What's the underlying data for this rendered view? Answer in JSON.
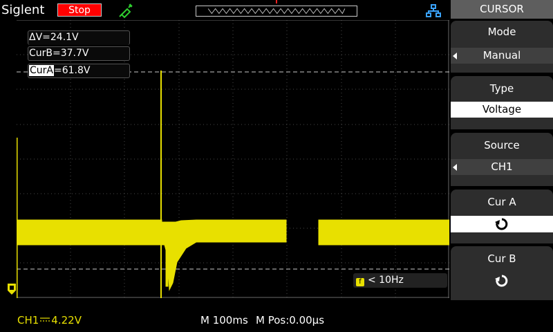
{
  "header": {
    "brand": "Siglent",
    "run_state": "Stop"
  },
  "cursor_readouts": {
    "delta": "ΔV=24.1V",
    "cur_b": "CurB=37.7V",
    "cur_a_label": "CurA",
    "cur_a_value": "=61.8V"
  },
  "trigger": {
    "freq_icon": "f",
    "freq_text": "< 10Hz"
  },
  "status": {
    "channel": "CH1",
    "coupling_icon": "dc-coupling-icon",
    "channel_scale": "4.22V",
    "timebase": "M 100ms",
    "position": "M Pos:0.00μs"
  },
  "menu": {
    "title": "CURSOR",
    "mode_label": "Mode",
    "mode_value": "Manual",
    "type_label": "Type",
    "type_value": "Voltage",
    "source_label": "Source",
    "source_value": "CH1",
    "cur_a_label": "Cur A",
    "cur_b_label": "Cur B"
  },
  "colors": {
    "trace": "#e8e000",
    "stop": "#ff0000",
    "menu_panel": "#2d2d2d",
    "accent_icon": "#3aa3ff"
  },
  "icons": [
    "probe-icon",
    "network-icon",
    "rotate-knob-icon",
    "trigger-level-marker-icon"
  ]
}
